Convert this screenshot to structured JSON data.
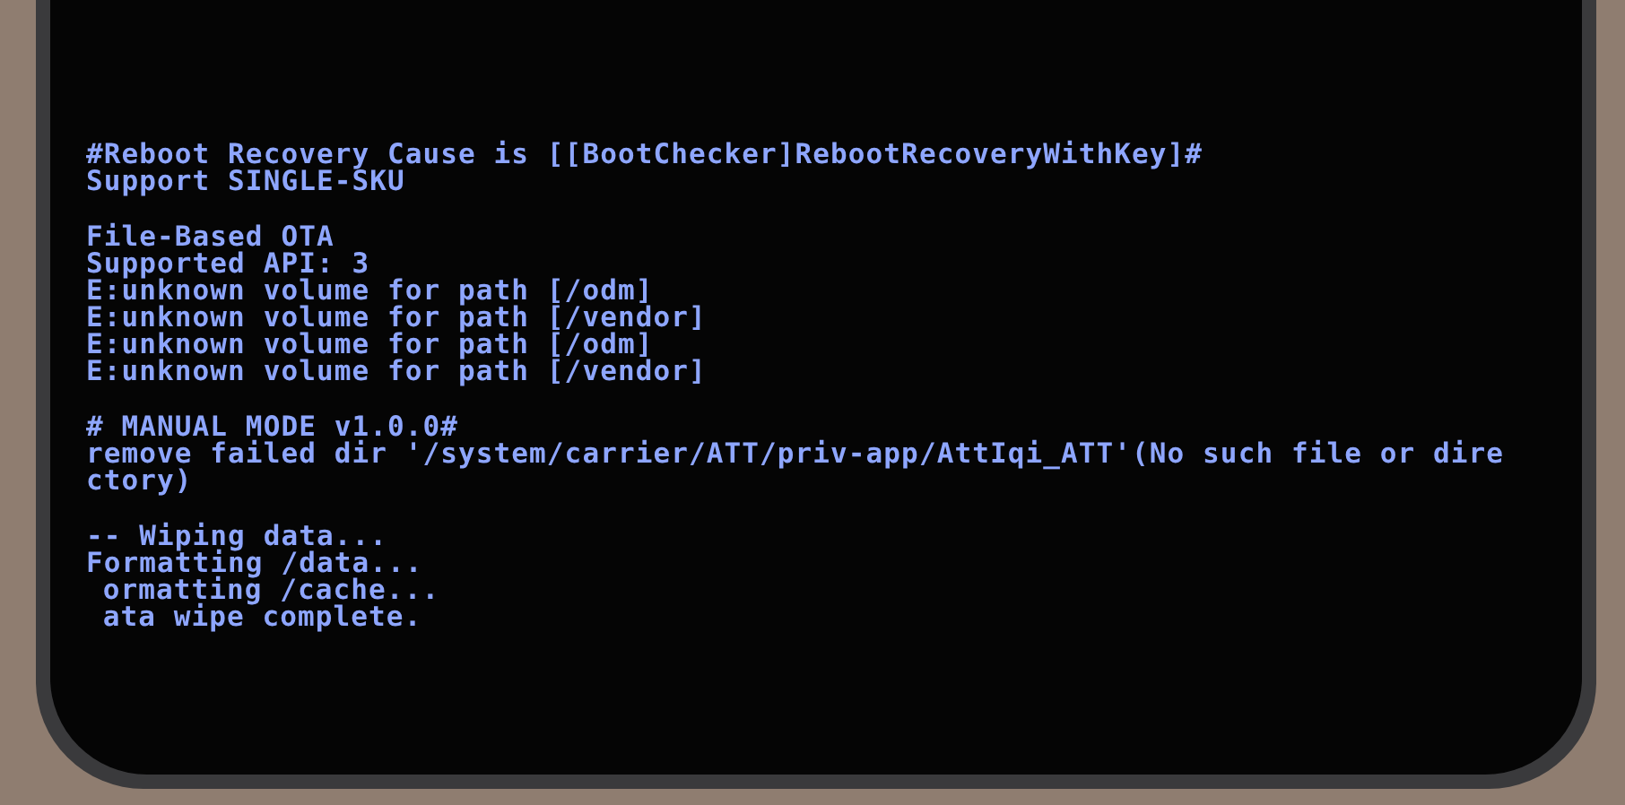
{
  "console": {
    "blocks": [
      {
        "lines": [
          {
            "text": "#Reboot Recovery Cause is [[BootChecker]RebootRecoveryWithKey]#",
            "kind": "full"
          },
          {
            "text": "Support SINGLE-SKU",
            "kind": "full"
          }
        ]
      },
      {
        "lines": [
          {
            "text": "File-Based OTA",
            "kind": "full"
          },
          {
            "text": "Supported API: 3",
            "kind": "full"
          },
          {
            "text": "E:unknown volume for path [/odm]",
            "kind": "full"
          },
          {
            "text": "E:unknown volume for path [/vendor]",
            "kind": "full"
          },
          {
            "text": "E:unknown volume for path [/odm]",
            "kind": "full"
          },
          {
            "text": "E:unknown volume for path [/vendor]",
            "kind": "full"
          }
        ]
      },
      {
        "lines": [
          {
            "text": "# MANUAL MODE v1.0.0#",
            "kind": "full"
          },
          {
            "text": "remove failed dir '/system/carrier/ATT/priv-app/AttIqi_ATT'(No such file or dire",
            "kind": "full"
          },
          {
            "text": "ctory)",
            "kind": "full"
          }
        ]
      },
      {
        "lines": [
          {
            "text": "-- Wiping data...",
            "kind": "full"
          },
          {
            "text": "Formatting /data...",
            "kind": "full"
          },
          {
            "text": "ormatting /cache...",
            "kind": "clipped"
          },
          {
            "text": "ata wipe complete.",
            "kind": "clipped"
          }
        ]
      }
    ]
  }
}
